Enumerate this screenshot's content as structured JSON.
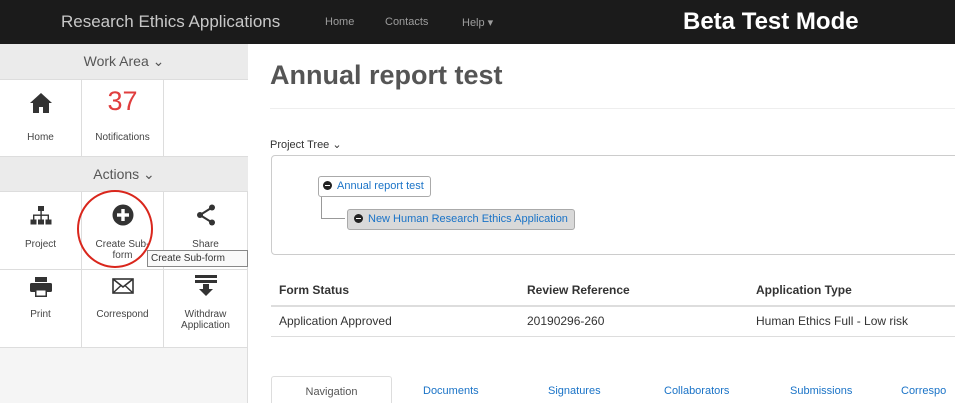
{
  "navbar": {
    "brand": "Research Ethics Applications",
    "links": {
      "home": "Home",
      "contacts": "Contacts",
      "help": "Help ▾"
    },
    "mode": "Beta Test Mode"
  },
  "sidebar": {
    "work_area": "Work Area ⌄",
    "home_label": "Home",
    "notifications_count": "37",
    "notifications_label": "Notifications",
    "actions": "Actions ⌄",
    "project_label": "Project",
    "create_sub_form_label_1": "Create Sub-",
    "create_sub_form_label_2": "form",
    "share_label": "Share",
    "print_label": "Print",
    "correspond_label": "Correspond",
    "withdraw_label_1": "Withdraw",
    "withdraw_label_2": "Application",
    "tooltip": "Create Sub-form"
  },
  "main": {
    "title": "Annual report test",
    "project_tree_label": "Project Tree ⌄",
    "tree": {
      "root": "Annual report test",
      "child": "New Human Research Ethics Application"
    },
    "table": {
      "headers": [
        "Form Status",
        "Review Reference",
        "Application Type"
      ],
      "row": [
        "Application Approved",
        "20190296-260",
        "Human Ethics Full - Low risk"
      ]
    },
    "tabs": [
      "Navigation",
      "Documents",
      "Signatures",
      "Collaborators",
      "Submissions",
      "Correspo"
    ]
  },
  "colors": {
    "navbar_bg": "#1b1b1b",
    "notification_red": "#e03e3e",
    "link_blue": "#1a73c7",
    "highlight_circle": "#d9261c"
  }
}
